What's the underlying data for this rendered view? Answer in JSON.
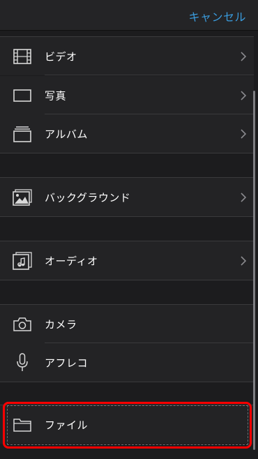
{
  "nav": {
    "cancel_label": "キャンセル"
  },
  "items": {
    "video": {
      "label": "ビデオ",
      "icon": "film-icon"
    },
    "photo": {
      "label": "写真",
      "icon": "photo-frame-icon"
    },
    "album": {
      "label": "アルバム",
      "icon": "album-stack-icon"
    },
    "background": {
      "label": "バックグラウンド",
      "icon": "landscape-image-icon"
    },
    "audio": {
      "label": "オーディオ",
      "icon": "music-note-icon"
    },
    "camera": {
      "label": "カメラ",
      "icon": "camera-icon"
    },
    "voiceover": {
      "label": "アフレコ",
      "icon": "microphone-icon"
    },
    "files": {
      "label": "ファイル",
      "icon": "folder-icon"
    }
  },
  "colors": {
    "accent": "#3a9bdc",
    "highlight": "#ff0000",
    "row_bg": "#232325",
    "page_bg": "#1c1c1e"
  }
}
